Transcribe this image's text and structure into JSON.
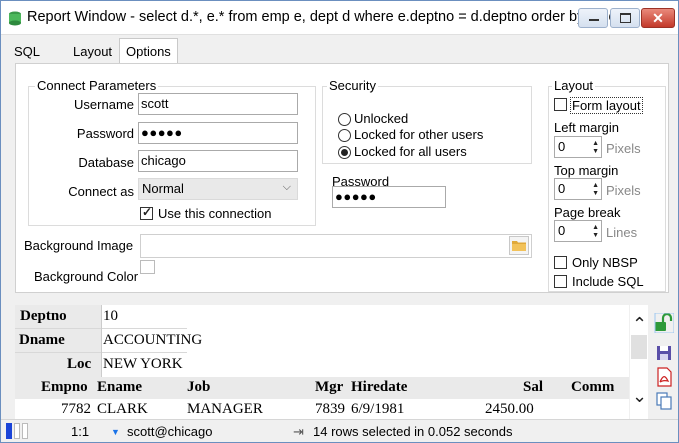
{
  "window": {
    "title": "Report Window - select d.*, e.* from emp e, dept d where e.deptno = d.deptno order by d.de..."
  },
  "tabs": [
    {
      "label": "SQL"
    },
    {
      "label": "Layout"
    },
    {
      "label": "Options"
    }
  ],
  "connect": {
    "title": "Connect Parameters",
    "username_label": "Username",
    "username_value": "scott",
    "password_label": "Password",
    "password_value": "●●●●●",
    "database_label": "Database",
    "database_value": "chicago",
    "connect_as_label": "Connect as",
    "connect_as_value": "Normal",
    "use_connection_label": "Use this connection",
    "use_connection_checked": true
  },
  "security": {
    "title": "Security",
    "options": [
      "Unlocked",
      "Locked for other users",
      "Locked for all users"
    ],
    "selected": "Locked for all users",
    "password_label": "Password",
    "password_value": "●●●●●"
  },
  "layout": {
    "title": "Layout",
    "form_layout_label": "Form layout",
    "left_margin_label": "Left margin",
    "left_margin_value": "0",
    "top_margin_label": "Top margin",
    "top_margin_value": "0",
    "page_break_label": "Page break",
    "page_break_value": "0",
    "unit_pixels": "Pixels",
    "unit_lines": "Lines",
    "only_nbsp_label": "Only NBSP",
    "include_sql_label": "Include SQL"
  },
  "background": {
    "image_label": "Background Image",
    "image_value": "",
    "color_label": "Background Color"
  },
  "report": {
    "detail": [
      {
        "label": "Deptno",
        "value": "10"
      },
      {
        "label": "Dname",
        "value": "ACCOUNTING"
      },
      {
        "label": "Loc",
        "value": "NEW YORK"
      }
    ],
    "columns": [
      "Empno",
      "Ename",
      "Job",
      "Mgr",
      "Hiredate",
      "Sal",
      "Comm"
    ],
    "rows": [
      [
        "7782",
        "CLARK",
        "MANAGER",
        "7839",
        "6/9/1981",
        "2450.00",
        ""
      ]
    ]
  },
  "status": {
    "position": "1:1",
    "connection": "scott@chicago",
    "message": "14 rows selected in 0.052 seconds"
  },
  "icons": {
    "app": "app-icon",
    "unlock": "unlock-icon",
    "save": "save-icon",
    "pdf": "pdf-icon",
    "copy": "copy-icon",
    "folder": "folder-icon"
  },
  "colors": {
    "accent": "#1a73e8",
    "unlock_green": "#2e9a3a",
    "pdf_red": "#cc2222",
    "close_red": "#c3392a"
  }
}
